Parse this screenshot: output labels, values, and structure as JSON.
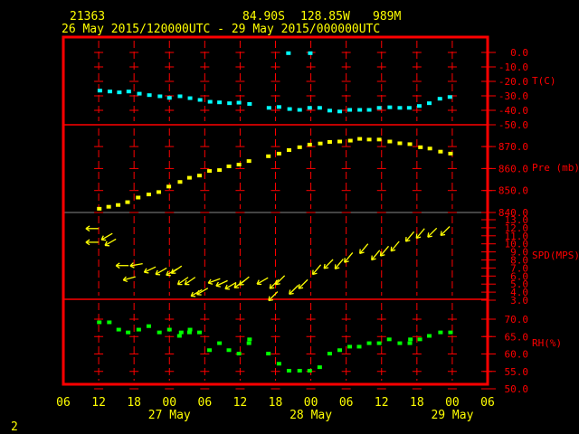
{
  "header": {
    "station": "21363",
    "lat": "84.90S",
    "lon": "128.85W",
    "elev": "989M",
    "period": "26 May 2015/120000UTC - 29 May 2015/000000UTC"
  },
  "footer": {
    "page": "2"
  },
  "colors": {
    "frame": "#ff0000",
    "temp": "#00ffff",
    "pres": "#ffff00",
    "wind": "#ffff00",
    "rh": "#00ff00",
    "text": "#ffff00"
  },
  "chart_data": {
    "type": "scatter",
    "x_units": "hours since 26 May 2015 06UTC",
    "xlim": [
      0,
      72
    ],
    "x_tick_labels": [
      "06",
      "12",
      "18",
      "00",
      "06",
      "12",
      "18",
      "00",
      "06",
      "12",
      "18",
      "00",
      "06"
    ],
    "date_labels": [
      {
        "label": "27 May",
        "h": 18
      },
      {
        "label": "28 May",
        "h": 42
      },
      {
        "label": "29 May",
        "h": 66
      }
    ],
    "panels": [
      {
        "name": "T(C)",
        "ylim": [
          -50,
          0
        ],
        "tick_values": [
          0,
          -10,
          -20,
          -30,
          -40,
          -50
        ],
        "tick_labels": [
          "0.0",
          "-10.0",
          "-20.0",
          "-30.0",
          "-40.0",
          "-50.0"
        ],
        "points": [
          [
            6.2,
            -26.4
          ],
          [
            7.9,
            -27
          ],
          [
            9.5,
            -27.6
          ],
          [
            11.1,
            -27
          ],
          [
            12.9,
            -28.5
          ],
          [
            14.6,
            -29.5
          ],
          [
            16.4,
            -30.3
          ],
          [
            18,
            -31.4
          ],
          [
            19.8,
            -30.3
          ],
          [
            21.5,
            -31.6
          ],
          [
            23.2,
            -32.8
          ],
          [
            24.9,
            -34.1
          ],
          [
            26.5,
            -34.5
          ],
          [
            28.2,
            -35.1
          ],
          [
            29.8,
            -34.7
          ],
          [
            31.6,
            -35.6
          ],
          [
            34.9,
            -38.3
          ],
          [
            36.6,
            -37.7
          ],
          [
            38.4,
            -39.1
          ],
          [
            40.1,
            -39.7
          ],
          [
            41.8,
            -38.3
          ],
          [
            43.5,
            -38.3
          ],
          [
            45.2,
            -40.2
          ],
          [
            46.9,
            -40.8
          ],
          [
            48.6,
            -39.7
          ],
          [
            50.3,
            -39.7
          ],
          [
            51.9,
            -39.7
          ],
          [
            53.6,
            -38.3
          ],
          [
            55.4,
            -37.9
          ],
          [
            57.1,
            -38.3
          ],
          [
            58.7,
            -38.3
          ],
          [
            60.4,
            -37
          ],
          [
            62.1,
            -35.1
          ],
          [
            63.9,
            -32
          ],
          [
            65.6,
            -30.8
          ],
          [
            38.2,
            -0.5
          ],
          [
            41.9,
            -0.5
          ]
        ]
      },
      {
        "name": "Pre (mb)",
        "ylim": [
          840,
          880
        ],
        "tick_values": [
          870,
          860,
          850,
          840
        ],
        "tick_labels": [
          "870.0",
          "860.0",
          "850.0",
          "840.0"
        ],
        "points": [
          [
            6.1,
            841.7
          ],
          [
            7.7,
            842.6
          ],
          [
            9.3,
            843.4
          ],
          [
            10.9,
            844.7
          ],
          [
            12.7,
            846.8
          ],
          [
            14.5,
            848.2
          ],
          [
            16.2,
            849.3
          ],
          [
            17.9,
            851.8
          ],
          [
            19.8,
            853.9
          ],
          [
            21.4,
            855.8
          ],
          [
            23.1,
            856.8
          ],
          [
            24.8,
            858.9
          ],
          [
            26.5,
            859.3
          ],
          [
            28.1,
            861
          ],
          [
            29.8,
            861.8
          ],
          [
            31.5,
            863.4
          ],
          [
            34.8,
            865.6
          ],
          [
            36.6,
            866.8
          ],
          [
            38.3,
            868.4
          ],
          [
            40.1,
            869.7
          ],
          [
            41.8,
            870.9
          ],
          [
            43.6,
            871.4
          ],
          [
            45.2,
            872.1
          ],
          [
            46.9,
            872.3
          ],
          [
            48.7,
            872.7
          ],
          [
            50.3,
            873.5
          ],
          [
            51.9,
            873.2
          ],
          [
            53.6,
            873.2
          ],
          [
            55.4,
            872.3
          ],
          [
            57.1,
            871.5
          ],
          [
            58.8,
            871.1
          ],
          [
            60.6,
            869.7
          ],
          [
            62.2,
            869.1
          ],
          [
            64,
            867.7
          ],
          [
            65.7,
            866.8
          ]
        ]
      },
      {
        "name": "SPD(MPS)",
        "ylim": [
          3,
          14
        ],
        "tick_values": [
          13,
          12,
          11,
          10,
          9,
          8,
          7,
          6,
          5,
          4,
          3
        ],
        "tick_labels": [
          "13.0",
          "12.0",
          "11.0",
          "10.0",
          "9.0",
          "8.0",
          "7.0",
          "6.0",
          "5.0",
          "4.0",
          "3.0"
        ],
        "wind_note": "[hour, speed m/s, direction from (deg)]",
        "points": [
          [
            4.9,
            11.9,
            90
          ],
          [
            4.9,
            10.2,
            90
          ],
          [
            7.4,
            10.9,
            60
          ],
          [
            8,
            10.2,
            60
          ],
          [
            10,
            7.3,
            90
          ],
          [
            11.2,
            5.7,
            75
          ],
          [
            12.4,
            7.4,
            80
          ],
          [
            14.7,
            6.8,
            65
          ],
          [
            16.6,
            6.6,
            60
          ],
          [
            18.4,
            6.5,
            60
          ],
          [
            19.2,
            6.8,
            55
          ],
          [
            20.3,
            5.4,
            55
          ],
          [
            21.5,
            5.4,
            55
          ],
          [
            22.6,
            3.9,
            60
          ],
          [
            23.6,
            4.1,
            60
          ],
          [
            25.6,
            5.4,
            70
          ],
          [
            26.9,
            5.1,
            65
          ],
          [
            28.4,
            4.8,
            60
          ],
          [
            29.9,
            5,
            55
          ],
          [
            30.7,
            5.4,
            50
          ],
          [
            33.8,
            5.4,
            60
          ],
          [
            35.8,
            5,
            45
          ],
          [
            36.8,
            5.5,
            45
          ],
          [
            35.6,
            3.5,
            45
          ],
          [
            39.1,
            4.3,
            45
          ],
          [
            40.7,
            5,
            45
          ],
          [
            43,
            6.8,
            40
          ],
          [
            45,
            7.5,
            45
          ],
          [
            46.8,
            7.5,
            40
          ],
          [
            48.4,
            8.3,
            40
          ],
          [
            51,
            9.4,
            40
          ],
          [
            53,
            8.6,
            40
          ],
          [
            54.5,
            9.1,
            40
          ],
          [
            56.3,
            9.7,
            40
          ],
          [
            58.8,
            10.9,
            40
          ],
          [
            60.6,
            11.3,
            40
          ],
          [
            62.6,
            11.4,
            45
          ],
          [
            64.8,
            11.6,
            45
          ]
        ]
      },
      {
        "name": "RH(%)",
        "ylim": [
          50,
          75
        ],
        "tick_values": [
          70,
          65,
          60,
          55,
          50
        ],
        "tick_labels": [
          "70.0",
          "65.0",
          "60.0",
          "55.0",
          "50.0"
        ],
        "points": [
          [
            6.1,
            69.1
          ],
          [
            7.8,
            69.1
          ],
          [
            9.4,
            67
          ],
          [
            11,
            66.2
          ],
          [
            12.8,
            67
          ],
          [
            14.5,
            68
          ],
          [
            16.3,
            66.2
          ],
          [
            18,
            67
          ],
          [
            19.7,
            65.2
          ],
          [
            20,
            66.2
          ],
          [
            21.4,
            66.2
          ],
          [
            21.5,
            67
          ],
          [
            23.1,
            66.2
          ],
          [
            24.8,
            61.1
          ],
          [
            26.5,
            63.1
          ],
          [
            28.1,
            61.1
          ],
          [
            29.8,
            60.1
          ],
          [
            31.5,
            63.1
          ],
          [
            31.6,
            64.2
          ],
          [
            34.8,
            60.1
          ],
          [
            36.6,
            57.2
          ],
          [
            38.3,
            55.2
          ],
          [
            40.1,
            55.2
          ],
          [
            41.8,
            55.2
          ],
          [
            43.5,
            56.2
          ],
          [
            45.2,
            60.1
          ],
          [
            46.9,
            61.1
          ],
          [
            48.6,
            62.1
          ],
          [
            50.2,
            62.1
          ],
          [
            51.9,
            63.1
          ],
          [
            53.6,
            63.1
          ],
          [
            55.3,
            64.2
          ],
          [
            57.1,
            63.1
          ],
          [
            58.8,
            63.1
          ],
          [
            58.9,
            64.2
          ],
          [
            60.5,
            64.2
          ],
          [
            62.1,
            65.2
          ],
          [
            64,
            66.2
          ],
          [
            65.7,
            66.2
          ]
        ]
      }
    ]
  }
}
